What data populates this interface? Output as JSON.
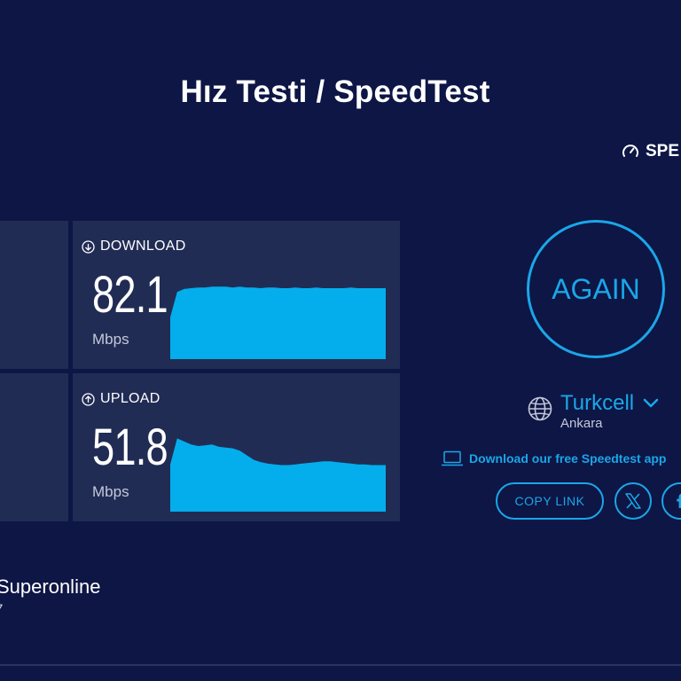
{
  "header": {
    "title": "Hız Testi / SpeedTest",
    "results_link": "SPE"
  },
  "download": {
    "label": "DOWNLOAD",
    "value": "82.1",
    "unit": "Mbps",
    "graph": [
      0.55,
      0.88,
      0.92,
      0.93,
      0.94,
      0.94,
      0.95,
      0.95,
      0.95,
      0.94,
      0.95,
      0.94,
      0.94,
      0.93,
      0.94,
      0.94,
      0.93,
      0.93,
      0.94,
      0.93,
      0.93,
      0.94,
      0.93,
      0.93,
      0.93,
      0.93,
      0.94,
      0.93,
      0.93,
      0.93,
      0.93,
      0.93
    ]
  },
  "upload": {
    "label": "UPLOAD",
    "value": "51.8",
    "unit": "Mbps",
    "graph": [
      0.62,
      0.96,
      0.92,
      0.88,
      0.86,
      0.87,
      0.88,
      0.85,
      0.84,
      0.83,
      0.8,
      0.74,
      0.68,
      0.65,
      0.63,
      0.62,
      0.61,
      0.61,
      0.62,
      0.63,
      0.64,
      0.65,
      0.66,
      0.66,
      0.65,
      0.64,
      0.63,
      0.62,
      0.62,
      0.61,
      0.61,
      0.61
    ]
  },
  "actions": {
    "again": "AGAIN",
    "copy_link": "COPY LINK"
  },
  "server": {
    "name": "Turkcell",
    "city": "Ankara"
  },
  "app_link": "Download our free Speedtest app",
  "isp": {
    "name": "Superonline",
    "sub": "7"
  },
  "colors": {
    "background": "#0d1645",
    "panel": "#212c55",
    "accent": "#1ba6e8",
    "graph_fill": "#04aeec"
  },
  "icons": {
    "results": "gauge-icon",
    "download": "download-arrow-icon",
    "upload": "upload-arrow-icon",
    "server": "globe-icon",
    "dropdown": "chevron-down-icon",
    "app": "laptop-icon",
    "twitter": "x-logo-icon",
    "facebook": "facebook-icon"
  }
}
